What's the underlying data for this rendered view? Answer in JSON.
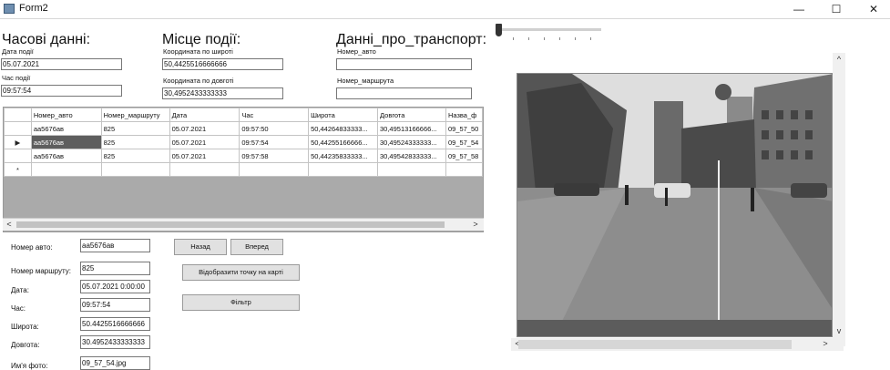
{
  "window": {
    "title": "Form2",
    "minimize": "—",
    "maximize": "☐",
    "close": "✕"
  },
  "groups": {
    "time": {
      "heading": "Часові данні:",
      "date_label": "Дата події",
      "date_value": "05.07.2021",
      "time_label": "Час події",
      "time_value": "09:57:54"
    },
    "place": {
      "heading": "Місце події:",
      "lat_label": "Координата по широті",
      "lat_value": "50,4425516666666",
      "lon_label": "Координата по довготі",
      "lon_value": "30,4952433333333"
    },
    "transport": {
      "heading": "Данні_про_транспорт:",
      "number_label": "Номер_авто",
      "number_value": "",
      "route_label": "Номер_маршрута",
      "route_value": ""
    }
  },
  "grid": {
    "columns": [
      "Номер_авто",
      "Номер_маршруту",
      "Дата",
      "Час",
      "Широта",
      "Довгота",
      "Назва_ф"
    ],
    "rows": [
      [
        "аа5676ав",
        "825",
        "05.07.2021",
        "09:57:50",
        "50,44264833333...",
        "30,49513166666...",
        "09_57_50"
      ],
      [
        "аа5676ав",
        "825",
        "05.07.2021",
        "09:57:54",
        "50,44255166666...",
        "30,49524333333...",
        "09_57_54"
      ],
      [
        "аа5676ав",
        "825",
        "05.07.2021",
        "09:57:58",
        "50,44235833333...",
        "30,49542833333...",
        "09_57_58"
      ]
    ],
    "selected_marker": "▶",
    "new_row_marker": "*"
  },
  "details": {
    "car_label": "Номер авто:",
    "car_value": "аа5676ав",
    "route_label": "Номер маршруту:",
    "route_value": "825",
    "date_label": "Дата:",
    "date_value": "05.07.2021 0:00:00",
    "time_label": "Час:",
    "time_value": "09:57:54",
    "lat_label": "Широта:",
    "lat_value": "50.4425516666666",
    "lon_label": "Довгота:",
    "lon_value": "30.4952433333333",
    "photo_label": "Им'я фото:",
    "photo_value": "09_57_54.jpg"
  },
  "buttons": {
    "back": "Назад",
    "forward": "Вперед",
    "show_map": "Відобразити точку на карті",
    "filter": "Фільтр"
  },
  "scroll": {
    "left": "<",
    "right": ">",
    "up": "^",
    "down": "v"
  },
  "icons": {
    "app": "form-icon"
  }
}
